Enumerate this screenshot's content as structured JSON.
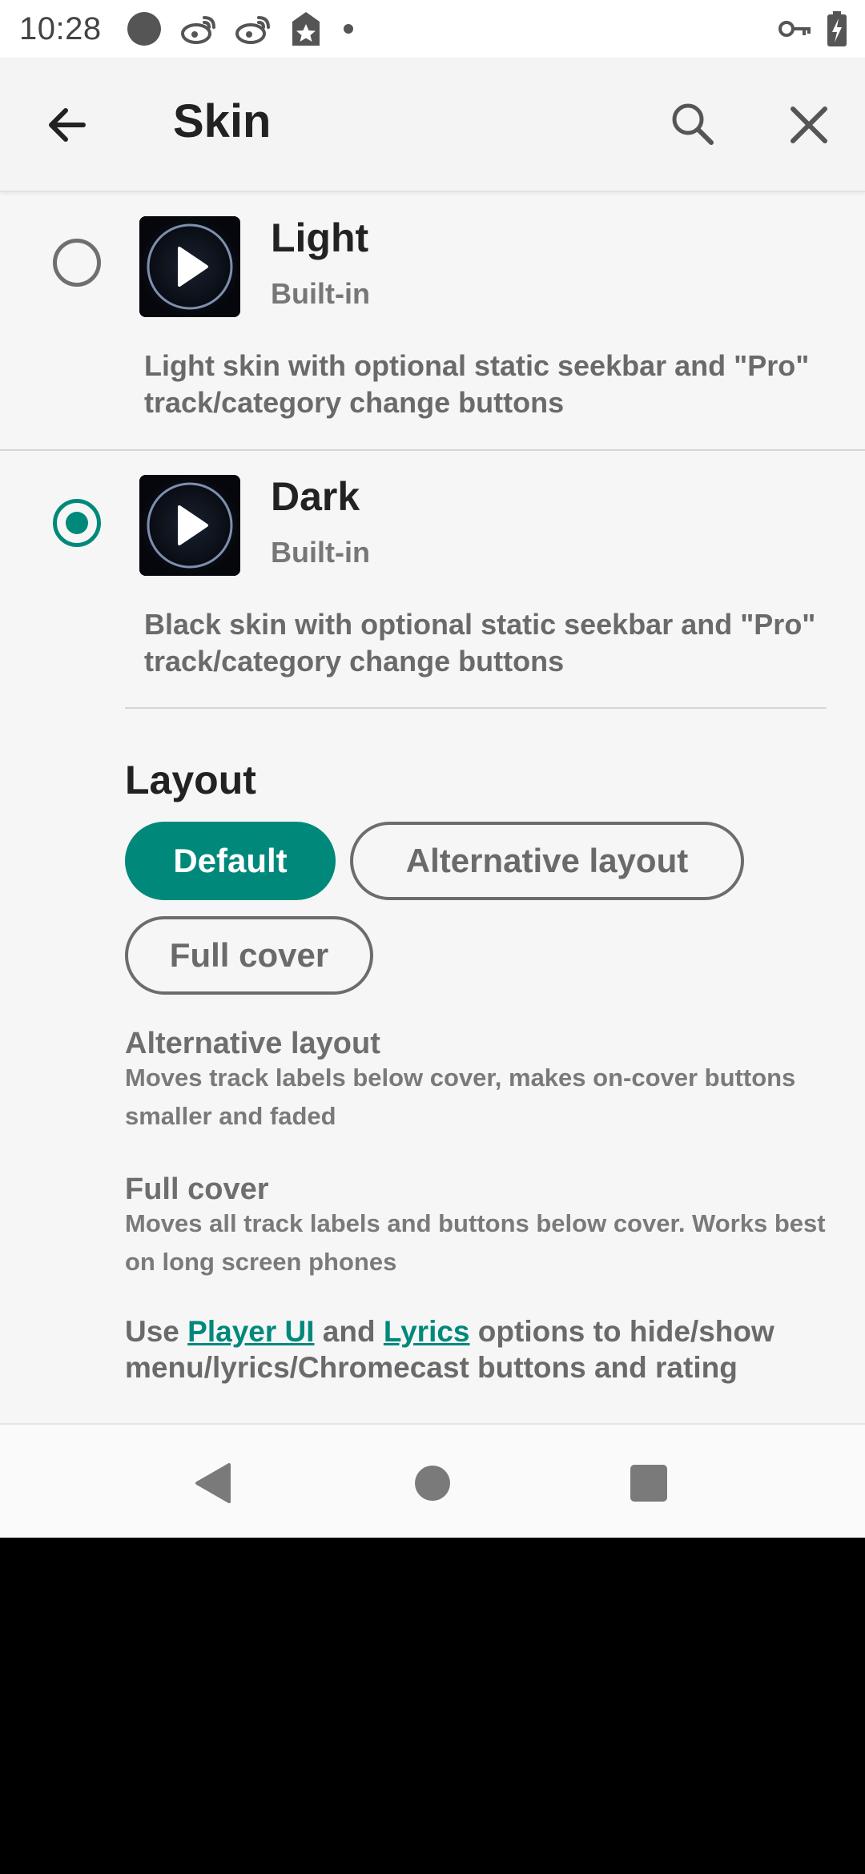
{
  "status_bar": {
    "time": "10:28",
    "left_icons": [
      "circle-icon",
      "weibo-icon",
      "weibo-icon",
      "star-tag-icon",
      "dot-icon"
    ],
    "right_icons": [
      "vpn-key-icon",
      "battery-charging-icon"
    ]
  },
  "app_bar": {
    "title": "Skin",
    "back_icon": "arrow-left-icon",
    "search_icon": "search-icon",
    "close_icon": "close-icon"
  },
  "skins": [
    {
      "name": "Light",
      "subtitle": "Built-in",
      "description": "Light skin with optional static seekbar and \"Pro\" track/category change buttons",
      "selected": false
    },
    {
      "name": "Dark",
      "subtitle": "Built-in",
      "description": "Black skin with optional static seekbar and \"Pro\" track/category change buttons",
      "selected": true
    }
  ],
  "layout": {
    "heading": "Layout",
    "chips": [
      {
        "label": "Default",
        "selected": true
      },
      {
        "label": "Alternative layout",
        "selected": false
      },
      {
        "label": "Full cover",
        "selected": false
      }
    ],
    "options": [
      {
        "title": "Alternative layout",
        "description": "Moves track labels below cover, makes on-cover buttons smaller and faded"
      },
      {
        "title": "Full cover",
        "description": "Moves all track labels and buttons below cover. Works best on long screen phones"
      }
    ],
    "footer": {
      "prefix": "Use ",
      "link1": "Player UI",
      "middle": " and ",
      "link2": "Lyrics",
      "suffix": " options to hide/show menu/lyrics/Chromecast buttons and rating"
    }
  },
  "nav_bar": {
    "icons": [
      "nav-back-icon",
      "nav-home-icon",
      "nav-recents-icon"
    ]
  },
  "colors": {
    "accent": "#00897b",
    "background": "#f6f6f6",
    "text_primary": "#222222",
    "text_secondary": "#6a6a6a"
  }
}
